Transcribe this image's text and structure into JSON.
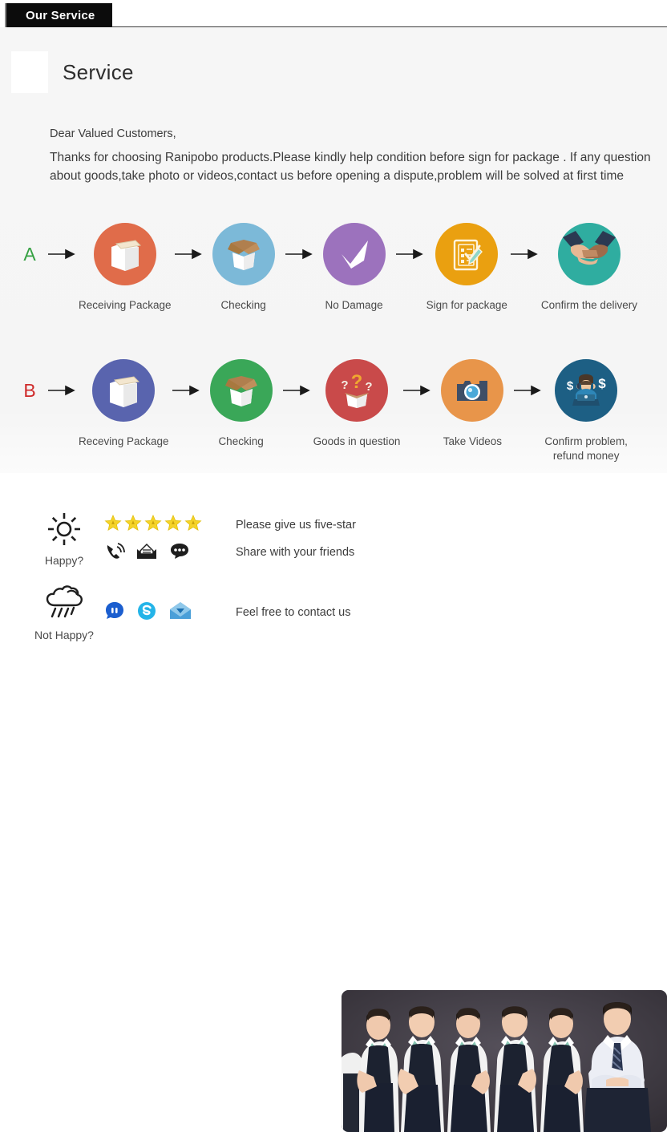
{
  "header": {
    "tab_label": "Our Service"
  },
  "service": {
    "title": "Service",
    "greeting": "Dear Valued Customers,",
    "body": "Thanks for choosing Ranipobo products.Please kindly help condition before sign for package . If any question about goods,take photo or videos,contact us before opening a dispute,problem will be solved at first time"
  },
  "flow_rows": [
    {
      "letter": "A",
      "letter_color": "#35a143",
      "steps": [
        {
          "label": "Receiving Package",
          "icon": "closed-box-icon",
          "circle_color": "#e06c4a"
        },
        {
          "label": "Checking",
          "icon": "open-box-icon",
          "circle_color": "#7cb9d8"
        },
        {
          "label": "No Damage",
          "icon": "checkmark-icon",
          "circle_color": "#9c72bd"
        },
        {
          "label": "Sign for package",
          "icon": "clipboard-pen-icon",
          "circle_color": "#eaa010"
        },
        {
          "label": "Confirm the delivery",
          "icon": "handshake-icon",
          "circle_color": "#2fada0"
        }
      ]
    },
    {
      "letter": "B",
      "letter_color": "#cf2a2a",
      "steps": [
        {
          "label": "Receving Package",
          "icon": "closed-box-icon",
          "circle_color": "#5964ae"
        },
        {
          "label": "Checking",
          "icon": "open-box-icon",
          "circle_color": "#3aa758"
        },
        {
          "label": "Goods in question",
          "icon": "question-box-icon",
          "circle_color": "#c94a4a"
        },
        {
          "label": "Take Videos",
          "icon": "camera-icon",
          "circle_color": "#e8954a"
        },
        {
          "label": "Confirm problem,\nrefund money",
          "icon": "support-agent-icon",
          "circle_color": "#1d5f84"
        }
      ]
    }
  ],
  "contact": {
    "rows": [
      {
        "mood_label": "Happy?",
        "mood_icon": "sun-icon",
        "icon_lines": [
          {
            "icons": [
              "star-icon",
              "star-icon",
              "star-icon",
              "star-icon",
              "star-icon"
            ],
            "text": "Please give us five-star"
          },
          {
            "icons": [
              "phone-icon",
              "envelope-icon",
              "chat-bubble-icon"
            ],
            "text": "Share with your friends"
          }
        ]
      },
      {
        "mood_label": "Not Happy?",
        "mood_icon": "rain-cloud-icon",
        "icon_lines": [
          {
            "icons": [
              "trademanager-icon",
              "skype-icon",
              "mail-blue-icon"
            ],
            "text": "Feel free to contact us"
          }
        ]
      }
    ],
    "star_count": 5,
    "star_color": "#f5d327"
  },
  "team_photo": {
    "alt": "customer service team photo",
    "people_count": 6
  }
}
